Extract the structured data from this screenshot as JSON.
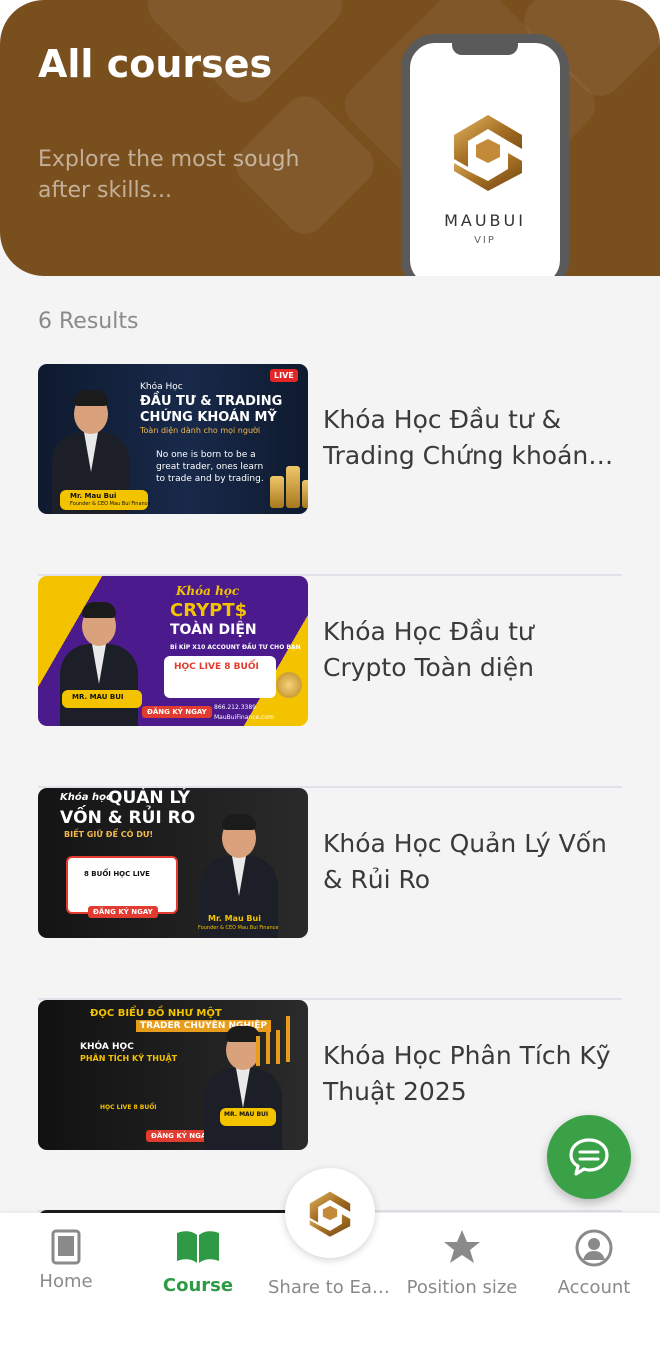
{
  "header": {
    "title": "All courses",
    "subtitle": "Explore the most sough after skills...",
    "brand_name": "MAUBUI",
    "brand_sub": "VIP"
  },
  "results_label": "6 Results",
  "courses": [
    {
      "title": "Khóa Học Đầu tư & Trading Chứng khoán Mỹ",
      "thumb": {
        "kicker": "Khóa Học",
        "headline1": "ĐẦU TƯ & TRADING",
        "headline2": "CHỨNG KHOÁN MỸ",
        "tagline": "Toàn diện dành cho mọi người",
        "badge": "LIVE",
        "quote1": "No one is born to be a",
        "quote2": "great trader, ones learn",
        "quote3": "to trade and by trading.",
        "presenter": "Mr. Mau Bui",
        "role": "Founder & CEO Mau Bui Finance"
      }
    },
    {
      "title": "Khóa Học Đầu tư Crypto Toàn diện",
      "thumb": {
        "kicker": "Khóa học",
        "headline1": "CRYPT$",
        "headline2": "TOÀN DIỆN",
        "tagline": "BÍ KÍP X10 ACCOUNT ĐẦU TƯ CHO BẠN",
        "live": "HỌC LIVE 8 BUỔI",
        "cta": "ĐĂNG KÝ NGAY",
        "presenter": "MR. MAU BUI",
        "phone": "866.212.3389",
        "site": "MauBuiFinance.com"
      }
    },
    {
      "title": "Khóa Học Quản Lý Vốn & Rủi Ro",
      "thumb": {
        "kicker": "Khóa học",
        "headline1": "QUẢN LÝ",
        "headline2": "VỐN & RỦI RO",
        "tagline": "BIẾT GIỮ ĐỂ CÓ DƯ!",
        "live": "8 BUỔI HỌC LIVE",
        "cta": "ĐĂNG KÝ NGAY",
        "presenter": "Mr. Mau Bui",
        "role": "Founder & CEO Mau Bui Finance"
      }
    },
    {
      "title": "Khóa Học Phân Tích Kỹ Thuật 2025",
      "thumb": {
        "headline1": "ĐỌC BIỂU ĐỒ NHƯ MỘT",
        "headline2": "TRADER CHUYÊN NGHIỆP",
        "kicker": "KHÓA HỌC",
        "tagline": "PHÂN TÍCH KỸ THUẬT",
        "live": "HỌC LIVE 8 BUỔI",
        "cta": "ĐĂNG KÝ NGAY",
        "presenter": "MR. MAU BUI"
      }
    }
  ],
  "nav": {
    "home": "Home",
    "course": "Course",
    "share": "Share to Earn",
    "position": "Position size",
    "account": "Account"
  },
  "colors": {
    "header_bg": "#7a4f1e",
    "accent_green": "#2f9a45",
    "fab_green": "#3aa146",
    "gold": "#b98a3e"
  }
}
